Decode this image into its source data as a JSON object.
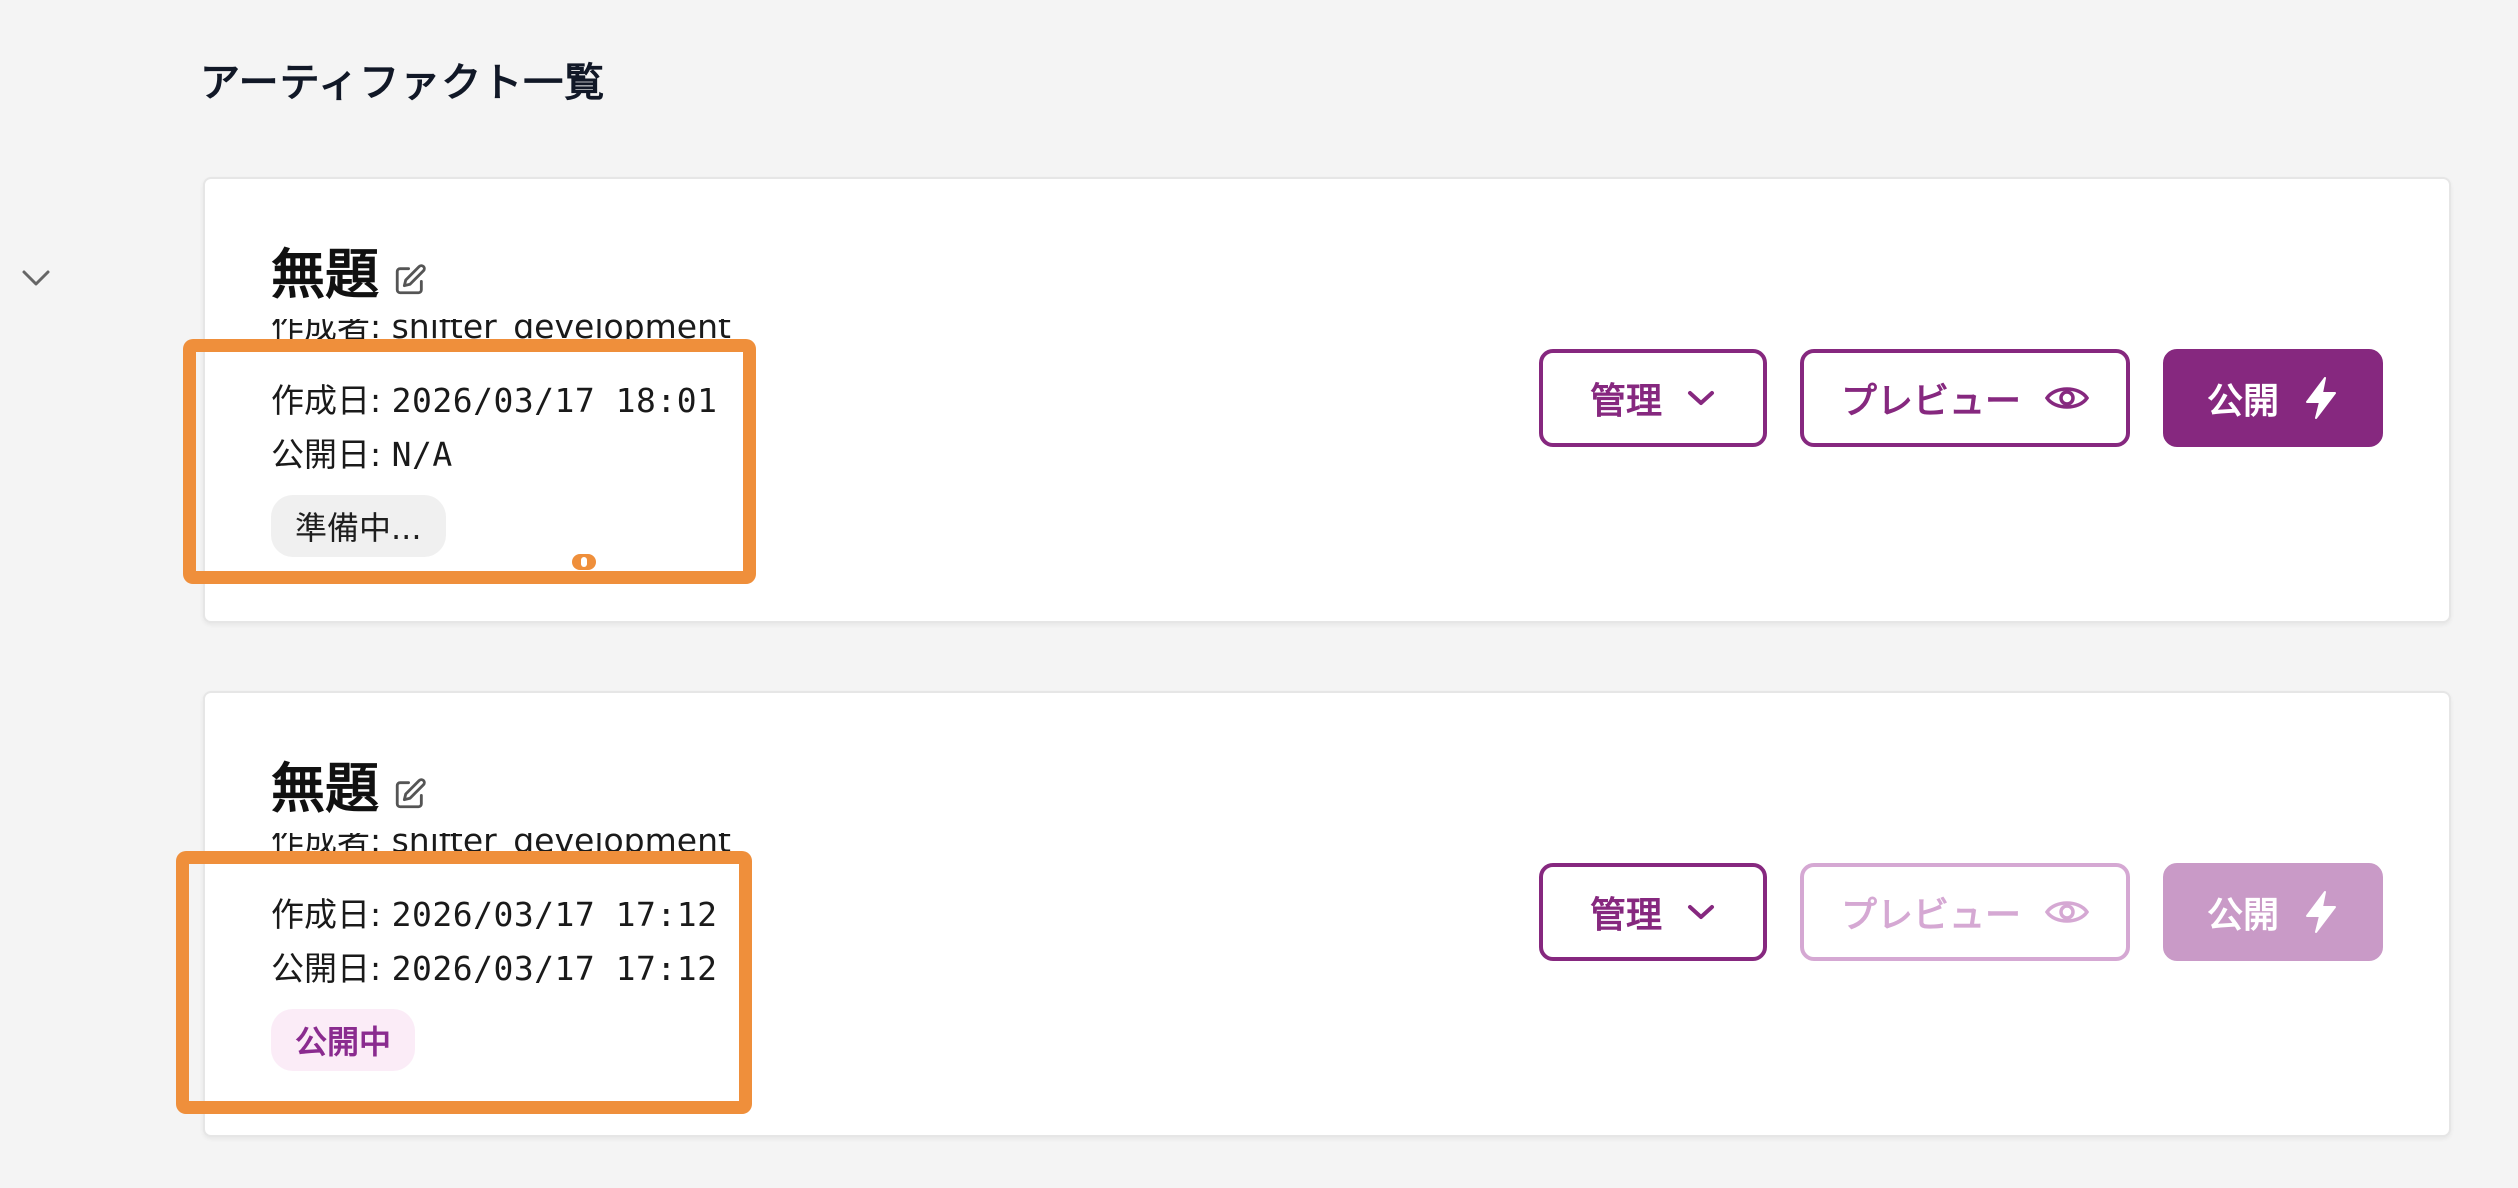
{
  "page": {
    "title": "アーティファクト一覧"
  },
  "colors": {
    "accent": "#86287f",
    "accent_disabled": "#c99ac7",
    "highlight": "#ef8f3b",
    "badge_public_bg": "#fbecf7"
  },
  "cards": [
    {
      "title": "無題",
      "author_label": "作成者: shifter_development",
      "created_label": "作成日: ",
      "created_value": "2026/03/17 18:01",
      "published_label": "公開日: ",
      "published_value": "N/A",
      "status": "準備中...",
      "buttons": {
        "manage": "管理",
        "preview": "プレビュー",
        "publish": "公開"
      },
      "preview_enabled": true,
      "publish_enabled": true
    },
    {
      "title": "無題",
      "author_label": "作成者: shifter_development",
      "created_label": "作成日: ",
      "created_value": "2026/03/17 17:12",
      "published_label": "公開日: ",
      "published_value": "2026/03/17 17:12",
      "status": "公開中",
      "buttons": {
        "manage": "管理",
        "preview": "プレビュー",
        "publish": "公開"
      },
      "preview_enabled": false,
      "publish_enabled": false
    }
  ],
  "icons": {
    "collapse": "chevron-down-icon",
    "edit": "edit-icon",
    "manage_dropdown": "chevron-down-icon",
    "preview": "eye-icon",
    "publish": "lightning-bolt-icon"
  }
}
